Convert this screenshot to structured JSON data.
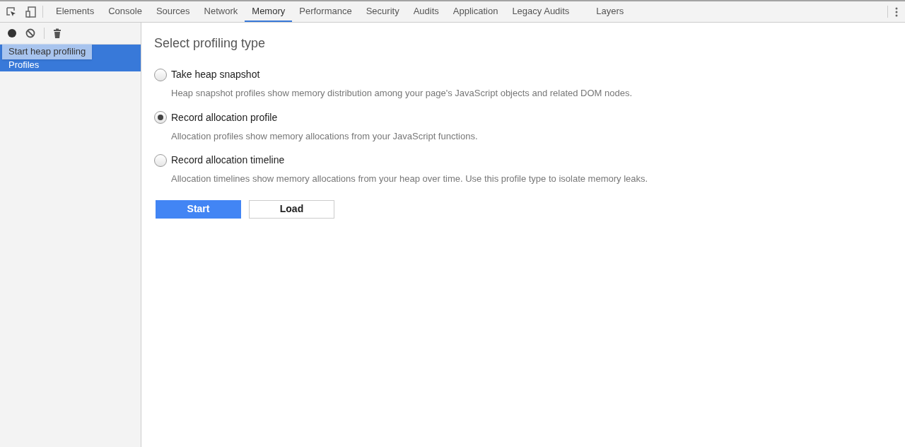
{
  "tabs": [
    {
      "label": "Elements",
      "selected": false
    },
    {
      "label": "Console",
      "selected": false
    },
    {
      "label": "Sources",
      "selected": false
    },
    {
      "label": "Network",
      "selected": false
    },
    {
      "label": "Memory",
      "selected": true
    },
    {
      "label": "Performance",
      "selected": false
    },
    {
      "label": "Security",
      "selected": false
    },
    {
      "label": "Audits",
      "selected": false
    },
    {
      "label": "Application",
      "selected": false
    },
    {
      "label": "Legacy Audits",
      "selected": false
    },
    {
      "label": "Layers",
      "selected": false
    }
  ],
  "sidebar": {
    "items": [
      {
        "label": "Profiles",
        "selected": true
      }
    ],
    "tooltip": "Start heap profiling"
  },
  "main": {
    "title": "Select profiling type",
    "options": [
      {
        "label": "Take heap snapshot",
        "description": "Heap snapshot profiles show memory distribution among your page's JavaScript objects and related DOM nodes.",
        "selected": false
      },
      {
        "label": "Record allocation profile",
        "description": "Allocation profiles show memory allocations from your JavaScript functions.",
        "selected": true
      },
      {
        "label": "Record allocation timeline",
        "description": "Allocation timelines show memory allocations from your heap over time. Use this profile type to isolate memory leaks.",
        "selected": false
      }
    ],
    "buttons": [
      {
        "label": "Start",
        "kind": "primary"
      },
      {
        "label": "Load",
        "kind": "secondary"
      }
    ]
  }
}
